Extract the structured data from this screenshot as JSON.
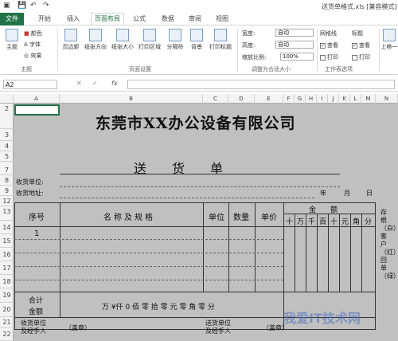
{
  "window": {
    "title": "送货单格式.xls [兼容模式]"
  },
  "tabs": [
    "文件",
    "开始",
    "插入",
    "页面布局",
    "公式",
    "数据",
    "审阅",
    "视图"
  ],
  "ribbon": {
    "theme": {
      "main": "主题",
      "colors": "颜色",
      "fonts": "字体",
      "effects": "效果",
      "group": "主题"
    },
    "page_setup": {
      "margins": "页边距",
      "orientation": "纸张方向",
      "size": "纸张大小",
      "print_area": "打印区域",
      "breaks": "分隔符",
      "background": "背景",
      "print_titles": "打印标题",
      "group": "页面设置"
    },
    "scale": {
      "width_label": "宽度:",
      "width_value": "自动",
      "height_label": "高度:",
      "height_value": "自动",
      "scale_label": "缩放比例:",
      "scale_value": "100%",
      "group": "调整为合适大小"
    },
    "sheet_options": {
      "gridlines": "网格线",
      "headings": "标题",
      "view": "查看",
      "print": "打印",
      "group": "工作表选项"
    },
    "arrange": {
      "bring_forward": "上移一"
    }
  },
  "formula_bar": {
    "name_box": "A2",
    "fx": "fx"
  },
  "columns": [
    "A",
    "B",
    "C",
    "D",
    "E",
    "F",
    "G",
    "H",
    "I",
    "J",
    "K",
    "L",
    "M",
    "N"
  ],
  "rows": [
    "2",
    "3",
    "4",
    "5",
    "7",
    "8",
    "9",
    "12",
    "13",
    "14",
    "15",
    "16",
    "17",
    "18",
    "19",
    "20",
    "21",
    "22"
  ],
  "sheet": {
    "company": "东莞市XX办公设备有限公司",
    "doc_title": "送　　货　　单",
    "recipient": "收货单位:",
    "address": "收货地址:",
    "year": "年",
    "month": "月",
    "day": "日",
    "col_no": "序号",
    "col_name": "名称及规格",
    "col_unit": "单位",
    "col_qty": "数量",
    "col_price": "单价",
    "col_amount": "金　　额",
    "amount_digits": [
      "十",
      "万",
      "千",
      "百",
      "十",
      "元",
      "角",
      "分"
    ],
    "row1_no": "1",
    "total1": "合计",
    "total2": "金额",
    "total_text": "万 ¥仟 0 佰 零 拾 零 元 零 角 零 分",
    "side_note": "存根（白）客户（红）回单（绿）",
    "recv_label": "收货单位\n及经手人",
    "stamp1": "（盖章）",
    "send_label": "送货单位\n及经手人",
    "stamp2": "（盖章）"
  },
  "watermark": "我爱IT技术网"
}
